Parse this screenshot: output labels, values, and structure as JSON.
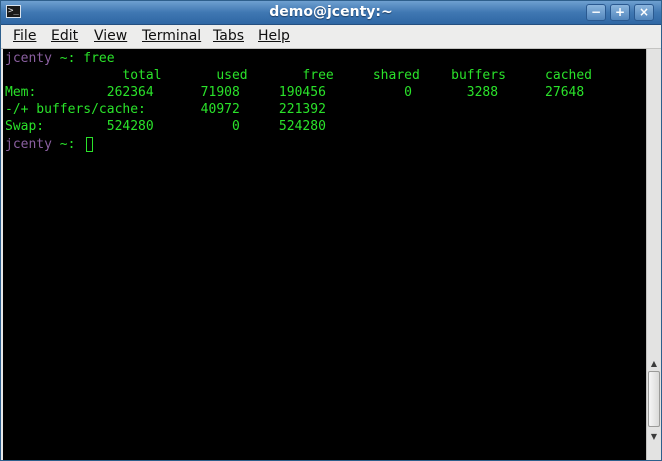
{
  "window": {
    "title": "demo@jcenty:~",
    "buttons": {
      "minimize": "−",
      "maximize": "+",
      "close": "×"
    }
  },
  "menu": [
    "File",
    "Edit",
    "View",
    "Terminal",
    "Tabs",
    "Help"
  ],
  "terminal": {
    "prompt_user": "jcenty",
    "prompt_suffix": " ~: ",
    "command": "free",
    "lines": [
      "               total       used       free     shared    buffers     cached",
      "Mem:         262364      71908     190456          0       3288      27648",
      "-/+ buffers/cache:       40972     221392",
      "Swap:        524280          0     524280"
    ]
  },
  "scrollbar": {
    "up": "▲",
    "down": "▼"
  },
  "colors": {
    "terminal_bg": "#000000",
    "terminal_fg": "#2ae22a",
    "prompt_user": "#8a5fa0",
    "titlebar": "#3f77b2"
  },
  "icons": {
    "app": "terminal-icon"
  }
}
